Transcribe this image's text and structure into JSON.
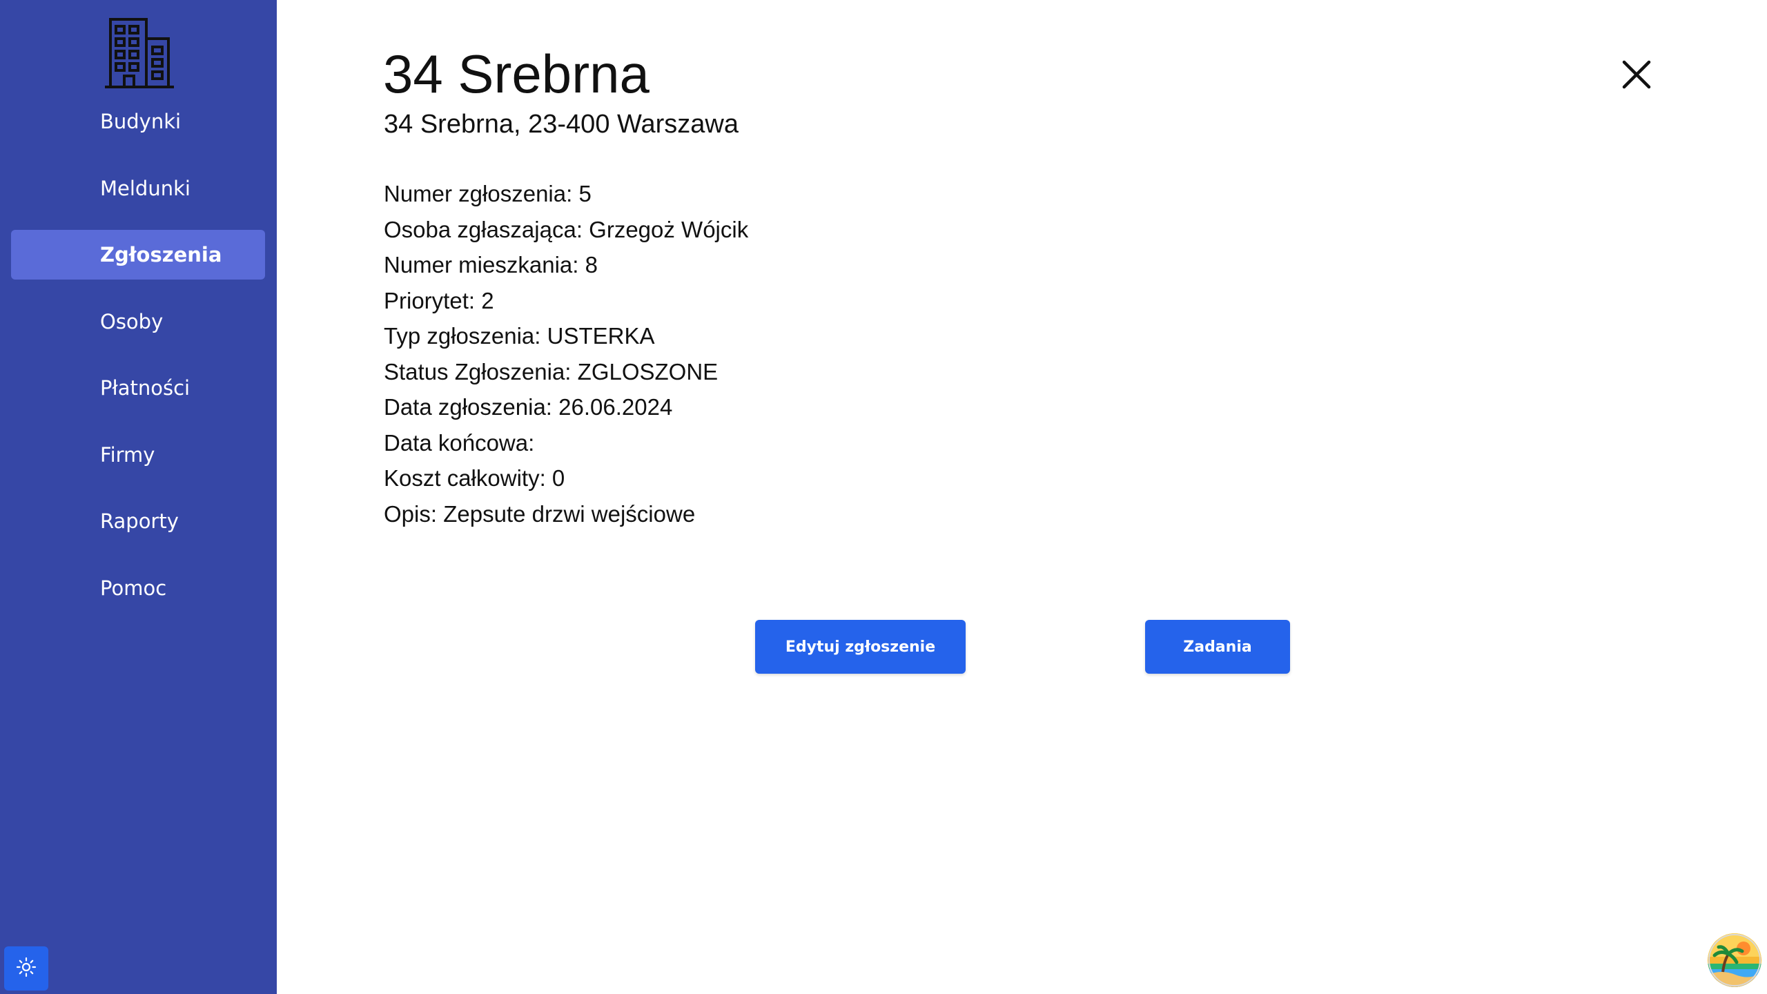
{
  "sidebar": {
    "logo_icon": "building-icon",
    "items": [
      {
        "label": "Budynki",
        "active": false
      },
      {
        "label": "Meldunki",
        "active": false
      },
      {
        "label": "Zgłoszenia",
        "active": true
      },
      {
        "label": "Osoby",
        "active": false
      },
      {
        "label": "Płatności",
        "active": false
      },
      {
        "label": "Firmy",
        "active": false
      },
      {
        "label": "Raporty",
        "active": false
      },
      {
        "label": "Pomoc",
        "active": false
      }
    ],
    "theme_toggle_icon": "sun-icon"
  },
  "main": {
    "title": "34 Srebrna",
    "address": "34 Srebrna, 23-400 Warszawa",
    "details": [
      {
        "label": "Numer zgłoszenia:",
        "value": "5"
      },
      {
        "label": "Osoba zgłaszająca:",
        "value": "Grzegoż Wójcik"
      },
      {
        "label": "Numer mieszkania:",
        "value": "8"
      },
      {
        "label": "Priorytet:",
        "value": "2"
      },
      {
        "label": "Typ zgłoszenia:",
        "value": "USTERKA"
      },
      {
        "label": "Status Zgłoszenia:",
        "value": "ZGLOSZONE"
      },
      {
        "label": "Data zgłoszenia:",
        "value": "26.06.2024"
      },
      {
        "label": "Data końcowa:",
        "value": ""
      },
      {
        "label": "Koszt całkowity:",
        "value": "0"
      },
      {
        "label": "Opis:",
        "value": "Zepsute drzwi wejściowe"
      }
    ],
    "buttons": {
      "edit_label": "Edytuj zgłoszenie",
      "tasks_label": "Zadania"
    },
    "close_icon": "close-icon"
  },
  "user": {
    "avatar_icon": "beach-avatar-icon"
  },
  "colors": {
    "sidebar_bg": "#3647a6",
    "nav_active_bg": "#5a6bd8",
    "button_bg": "#2563eb",
    "text": "#111111"
  }
}
